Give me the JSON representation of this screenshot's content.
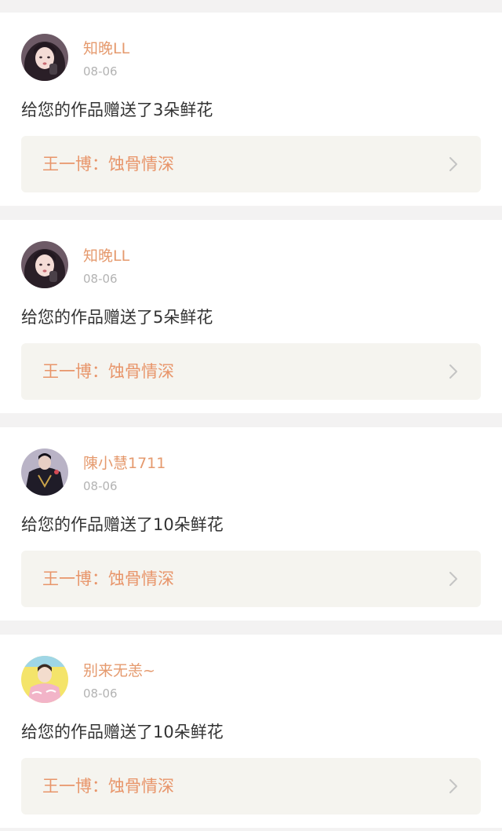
{
  "notifications": [
    {
      "user": "知晚LL",
      "date": "08-06",
      "message": "给您的作品赠送了3朵鲜花",
      "work": "王一博：蚀骨情深",
      "avatar": "avatar-girl-dark-hair-icon"
    },
    {
      "user": "知晚LL",
      "date": "08-06",
      "message": "给您的作品赠送了5朵鲜花",
      "work": "王一博：蚀骨情深",
      "avatar": "avatar-girl-dark-hair-icon"
    },
    {
      "user": "陳小慧1711",
      "date": "08-06",
      "message": "给您的作品赠送了10朵鲜花",
      "work": "王一博：蚀骨情深",
      "avatar": "avatar-man-dark-jacket-icon"
    },
    {
      "user": "别来无恙~",
      "date": "08-06",
      "message": "给您的作品赠送了10朵鲜花",
      "work": "王一博：蚀骨情深",
      "avatar": "avatar-boy-yellow-background-icon"
    }
  ],
  "colors": {
    "page_background": "#f3f2f2",
    "card_background": "#ffffff",
    "username": "#e59a6e",
    "date": "#b3b3b3",
    "message": "#333333",
    "work_box": "#f5f4ef",
    "work_title": "#e8956a",
    "chevron": "#c4c4c4"
  }
}
